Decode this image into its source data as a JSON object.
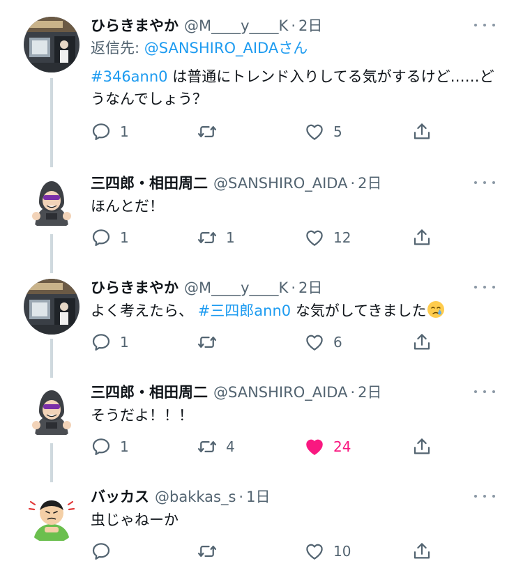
{
  "tweets": [
    {
      "name": "ひらきまやか",
      "handle": "@M____y____K",
      "time": "2日",
      "reply_to_label": "返信先: ",
      "reply_to_mention": "@SANSHIRO_AIDAさん",
      "hashtag": "#346ann0",
      "text_after": " は普通にトレンド入りしてる気がするけど……どうなんでしょう？",
      "reply_count": "1",
      "retweet_count": "",
      "like_count": "5"
    },
    {
      "name": "三四郎・相田周二",
      "handle": "@SANSHIRO_AIDA",
      "time": "2日",
      "text": "ほんとだ！",
      "reply_count": "1",
      "retweet_count": "1",
      "like_count": "12"
    },
    {
      "name": "ひらきまやか",
      "handle": "@M____y____K",
      "time": "2日",
      "text_before": "よく考えたら、 ",
      "hashtag": "#三四郎ann0",
      "text_after": " な気がしてきました",
      "emoji": "crying-face-emoji",
      "reply_count": "1",
      "retweet_count": "",
      "like_count": "6"
    },
    {
      "name": "三四郎・相田周二",
      "handle": "@SANSHIRO_AIDA",
      "time": "2日",
      "text": "そうだよ！！！",
      "reply_count": "1",
      "retweet_count": "4",
      "like_count": "24",
      "liked": true
    },
    {
      "name": "バッカス",
      "handle": "@bakkas_s",
      "time": "1日",
      "text": "虫じゃねーか",
      "reply_count": "",
      "retweet_count": "",
      "like_count": "10"
    }
  ],
  "colors": {
    "link": "#1d9bf0",
    "secondary_text": "#536471",
    "like_active": "#f91880",
    "thread_line": "#cfd9de"
  },
  "icons": [
    "reply-icon",
    "retweet-icon",
    "like-icon",
    "share-icon",
    "more-options-icon"
  ]
}
